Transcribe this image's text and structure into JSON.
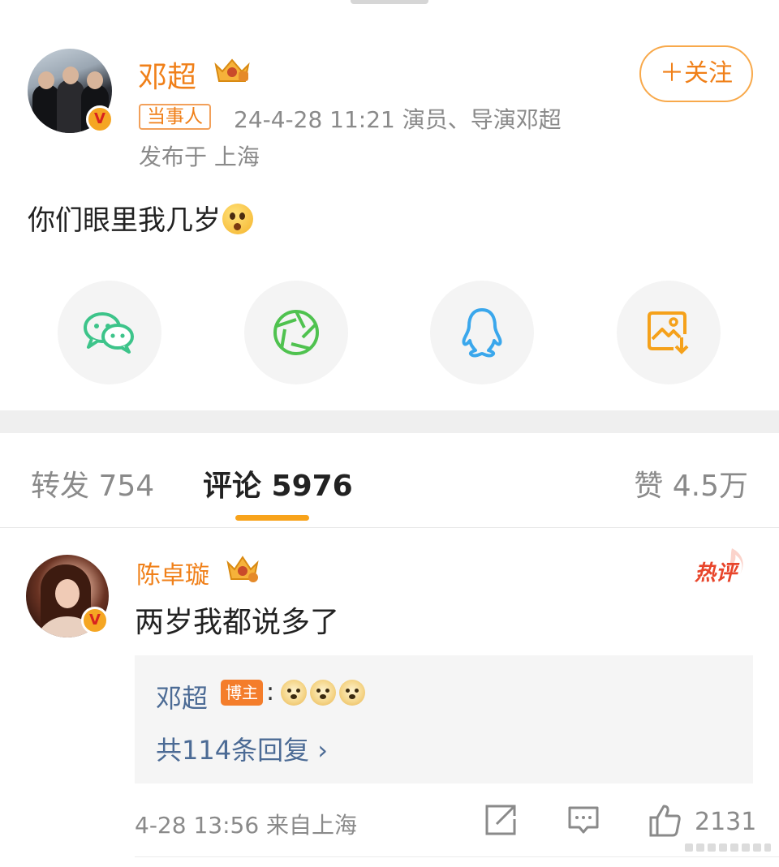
{
  "post": {
    "author": "邓超",
    "follow_label": "＋关注",
    "role_tag": "当事人",
    "meta": "24-4-28 11:21   演员、导演邓超",
    "location": "发布于 上海",
    "text": "你们眼里我几岁",
    "verified_mark": "V"
  },
  "share": {
    "items": [
      {
        "icon": "wechat-icon",
        "color": "#3dc48a"
      },
      {
        "icon": "moments-icon",
        "color": "#4fc24f"
      },
      {
        "icon": "qq-icon",
        "color": "#3aa7ec"
      },
      {
        "icon": "save-image-icon",
        "color": "#f5a11a"
      }
    ]
  },
  "tabs": {
    "repost": "转发 754",
    "comment": "评论 5976",
    "like": "赞 4.5万"
  },
  "comment": {
    "author": "陈卓璇",
    "text": "两岁我都说多了",
    "hot_label": "热评",
    "reply": {
      "author": "邓超",
      "host_tag": "博主",
      "colon": ":",
      "more": "共114条回复 ›"
    },
    "time": "4-28 13:56  来自上海",
    "like_count": "2131",
    "verified_mark": "V"
  },
  "colors": {
    "accent_orange": "#f08019",
    "tab_underline": "#f8a31b",
    "link_blue": "#4c6b95"
  }
}
